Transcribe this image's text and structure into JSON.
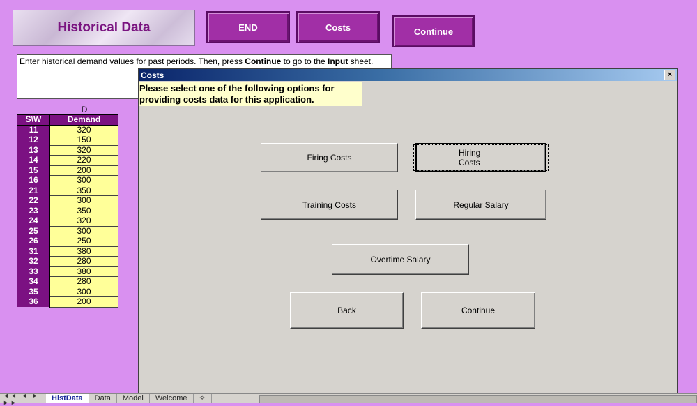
{
  "banner": {
    "title": "Historical Data",
    "end_label": "END",
    "costs_label": "Costs",
    "continue_label": "Continue"
  },
  "instructions": {
    "part1": "Enter historical demand values for past periods. Then, press ",
    "bold1": "Continue",
    "part2": " to go to the ",
    "bold2": "Input",
    "part3": " sheet."
  },
  "table": {
    "column_letter": "D",
    "headers": [
      "S\\W",
      "Demand"
    ],
    "rows": [
      {
        "id": "11",
        "demand": "320"
      },
      {
        "id": "12",
        "demand": "150"
      },
      {
        "id": "13",
        "demand": "320"
      },
      {
        "id": "14",
        "demand": "220"
      },
      {
        "id": "15",
        "demand": "200"
      },
      {
        "id": "16",
        "demand": "300"
      },
      {
        "id": "21",
        "demand": "350"
      },
      {
        "id": "22",
        "demand": "300"
      },
      {
        "id": "23",
        "demand": "350"
      },
      {
        "id": "24",
        "demand": "320"
      },
      {
        "id": "25",
        "demand": "300"
      },
      {
        "id": "26",
        "demand": "250"
      },
      {
        "id": "31",
        "demand": "380"
      },
      {
        "id": "32",
        "demand": "280"
      },
      {
        "id": "33",
        "demand": "380"
      },
      {
        "id": "34",
        "demand": "280"
      },
      {
        "id": "35",
        "demand": "300"
      },
      {
        "id": "36",
        "demand": "200"
      }
    ]
  },
  "dialog": {
    "title": "Costs",
    "close_glyph": "×",
    "message": "Please select one of the following options for providing costs data for this application.",
    "buttons": {
      "firing": "Firing Costs",
      "hiring": "Hiring Costs",
      "training": "Training Costs",
      "regular": "Regular Salary",
      "overtime": "Overtime Salary",
      "back": "Back",
      "continue": "Continue"
    }
  },
  "sheet_tabs": {
    "nav": "◄◄ ◄ ► ►►",
    "tabs": [
      "HistData",
      "Data",
      "Model",
      "Welcome"
    ],
    "active": "HistData"
  }
}
